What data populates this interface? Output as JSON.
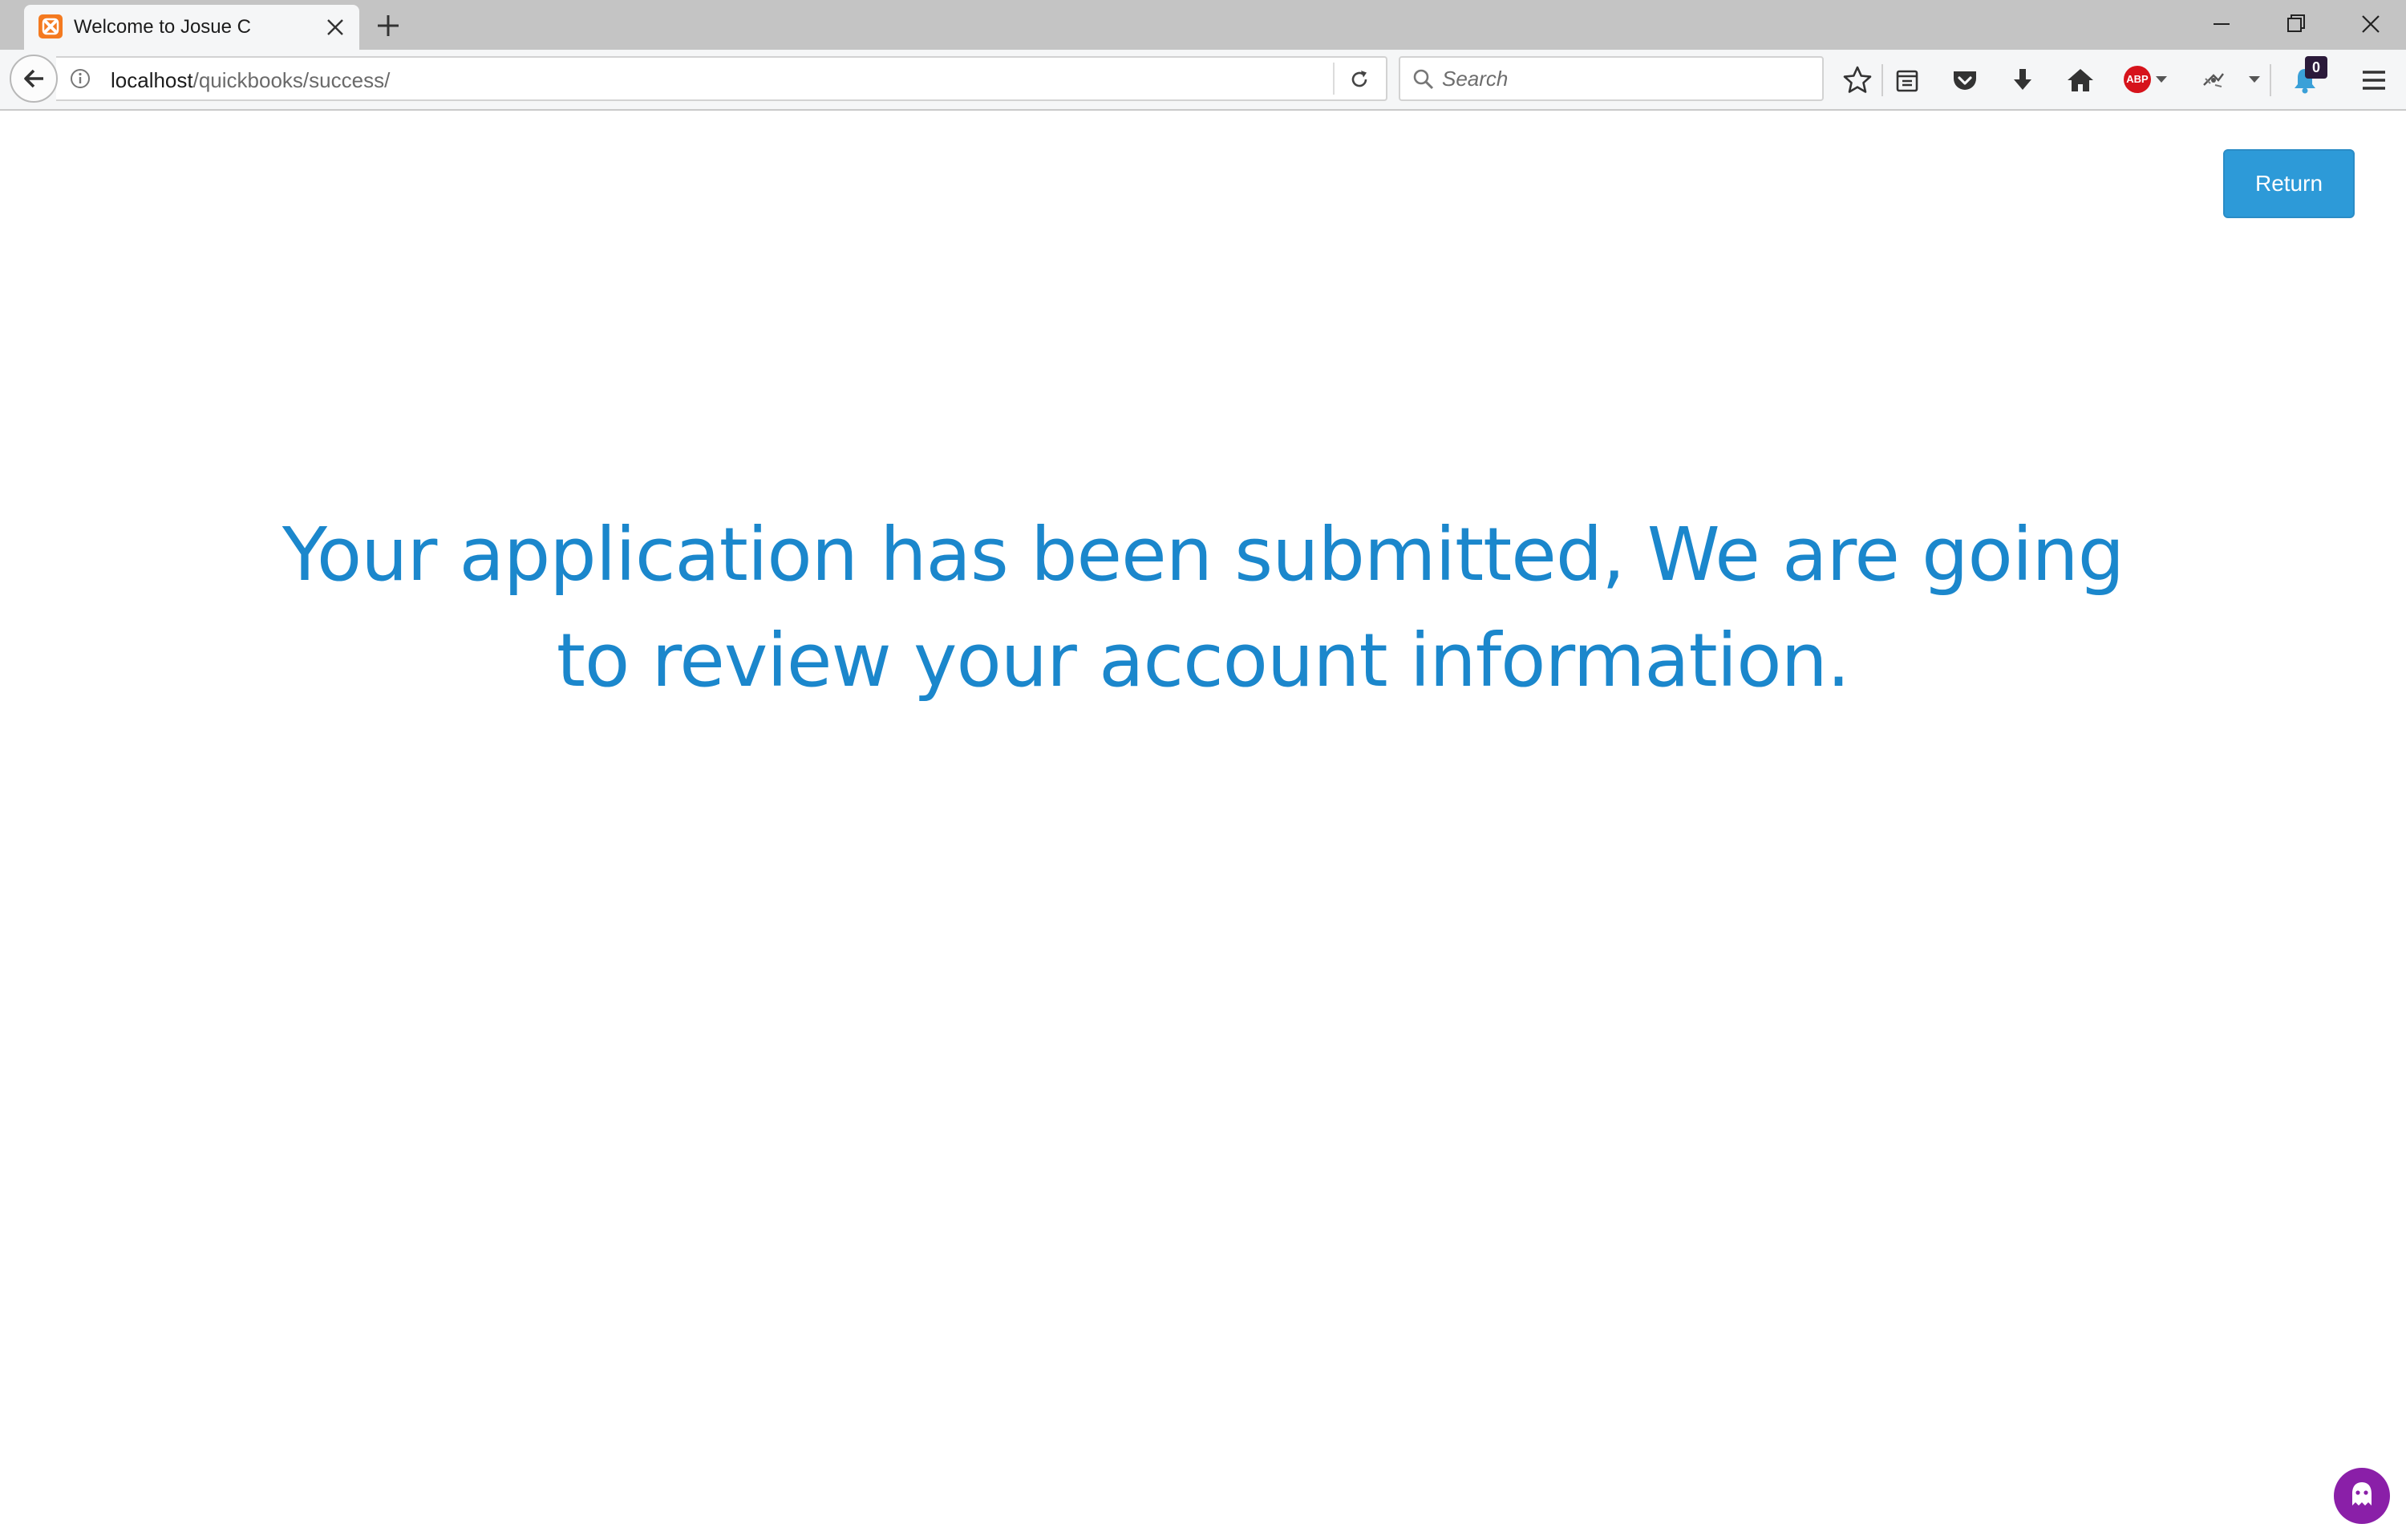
{
  "browser": {
    "tab": {
      "title": "Welcome to Josue C"
    },
    "address_bar": {
      "host": "localhost",
      "path": "/quickbooks/success/"
    },
    "search": {
      "placeholder": "Search"
    },
    "notifications": {
      "count": "0"
    },
    "adblock_label": "ABP",
    "toolbar_icons": [
      "star-icon",
      "reading-list-icon",
      "pocket-icon",
      "download-icon",
      "home-icon",
      "adblock-icon",
      "extension-icon",
      "notification-bell-icon",
      "menu-icon"
    ]
  },
  "page": {
    "return_label": "Return",
    "message": "Your application has been submitted, We are going to review your account information."
  },
  "colors": {
    "accent": "#1b87cc",
    "button": "#2d9ad8",
    "ghostery": "#8a1fa8"
  }
}
